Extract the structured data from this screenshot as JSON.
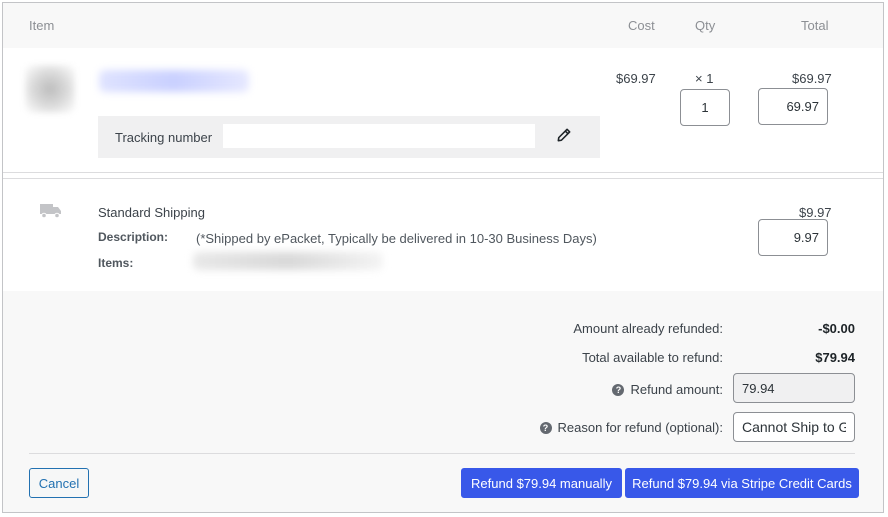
{
  "header": {
    "item": "Item",
    "cost": "Cost",
    "qty": "Qty",
    "total": "Total"
  },
  "line_item": {
    "cost": "$69.97",
    "qty_display": "× 1",
    "total": "$69.97",
    "refund_qty_value": "1",
    "refund_total_value": "69.97",
    "tracking_label": "Tracking number",
    "tracking_value": ""
  },
  "shipping": {
    "title": "Standard Shipping",
    "description_label": "Description:",
    "description_value": "(*Shipped by ePacket, Typically be delivered in 10-30 Business Days)",
    "items_label": "Items:",
    "total": "$9.97",
    "refund_total_value": "9.97"
  },
  "refund": {
    "already_refunded_label": "Amount already refunded:",
    "already_refunded_value": "-$0.00",
    "available_label": "Total available to refund:",
    "available_value": "$79.94",
    "amount_label": "Refund amount:",
    "amount_value": "79.94",
    "reason_label": "Reason for refund (optional):",
    "reason_value": "Cannot Ship to G"
  },
  "buttons": {
    "cancel": "Cancel",
    "manual": "Refund $79.94 manually",
    "stripe": "Refund $79.94 via Stripe Credit Cards"
  },
  "icons": {
    "help": "help-circle-icon",
    "edit": "pencil-icon",
    "shipping": "truck-icon"
  },
  "colors": {
    "primary": "#3858e9",
    "link": "#2271b1"
  }
}
